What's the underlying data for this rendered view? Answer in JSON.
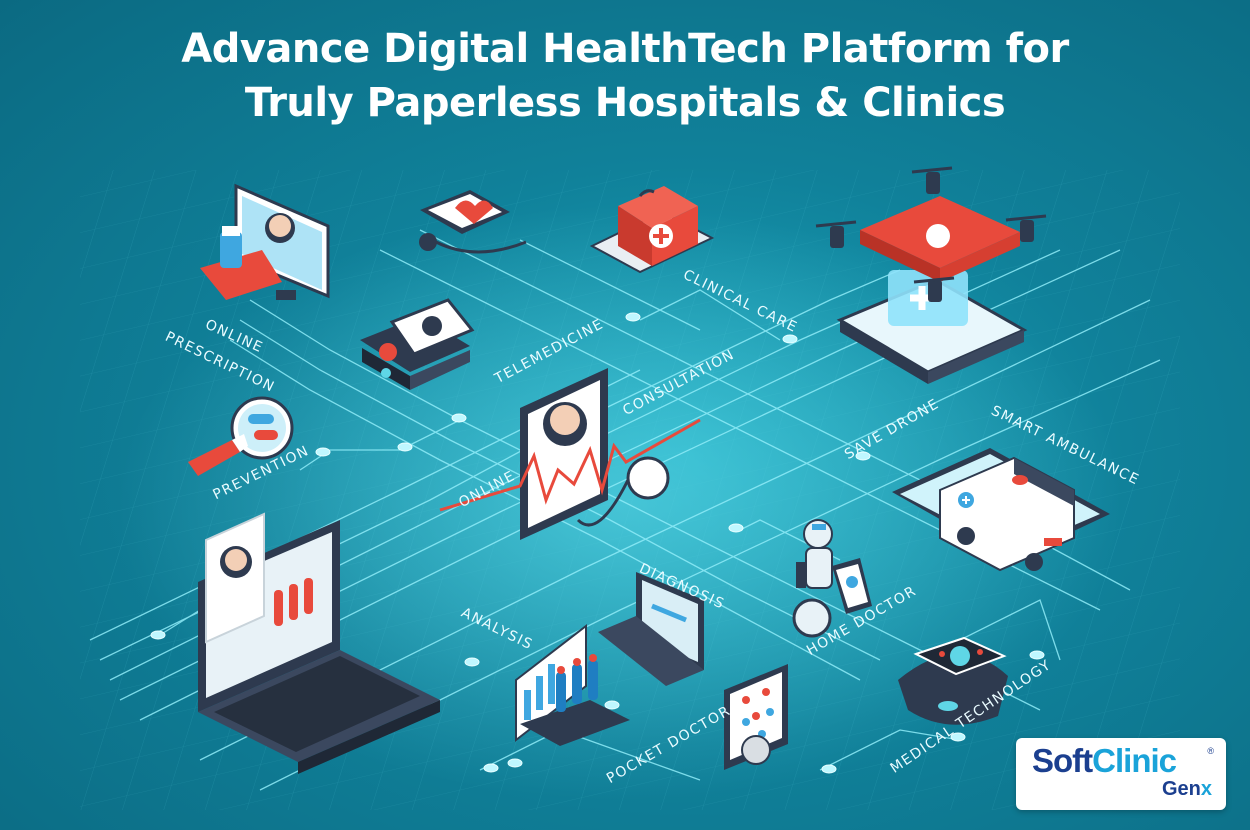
{
  "title": {
    "line1": "Advance Digital HealthTech Platform for",
    "line2": "Truly Paperless Hospitals & Clinics"
  },
  "labels": {
    "online": "ONLINE",
    "prescription": "PRESCRIPTION",
    "telemedicine": "TELEMEDICINE",
    "clinical_care": "CLINICAL CARE",
    "consultation": "CONSULTATION",
    "online_2": "ONLINE",
    "prevention": "PREVENTION",
    "save_drone": "SAVE DRONE",
    "smart_ambulance": "SMART AMBULANCE",
    "diagnosis": "DIAGNOSIS",
    "analysis": "ANALYSIS",
    "home_doctor": "HOME DOCTOR",
    "pocket_doctor": "POCKET DOCTOR",
    "medical_technology": "MEDICAL TECHNOLOGY"
  },
  "logo": {
    "soft": "Soft",
    "clinic": "Clinic",
    "gen": "Gen",
    "x": "x",
    "registered": "®"
  },
  "colors": {
    "background": "#10819a",
    "circuit": "#7fe8f7",
    "accent_red": "#e84a3c",
    "dark_device": "#2e3a4f",
    "logo_blue": "#1b3f8f",
    "logo_cyan": "#1aa3d9"
  },
  "icons": [
    "prescription-icon",
    "telemedicine-icon",
    "first-aid-kit-icon",
    "drone-icon",
    "prevention-icon",
    "heart-monitor-tablet-icon",
    "laptop-icon",
    "diagnosis-laptop-icon",
    "analysis-chart-icon",
    "robot-doctor-icon",
    "ambulance-icon",
    "pocket-doctor-icon",
    "smartwatch-icon"
  ]
}
